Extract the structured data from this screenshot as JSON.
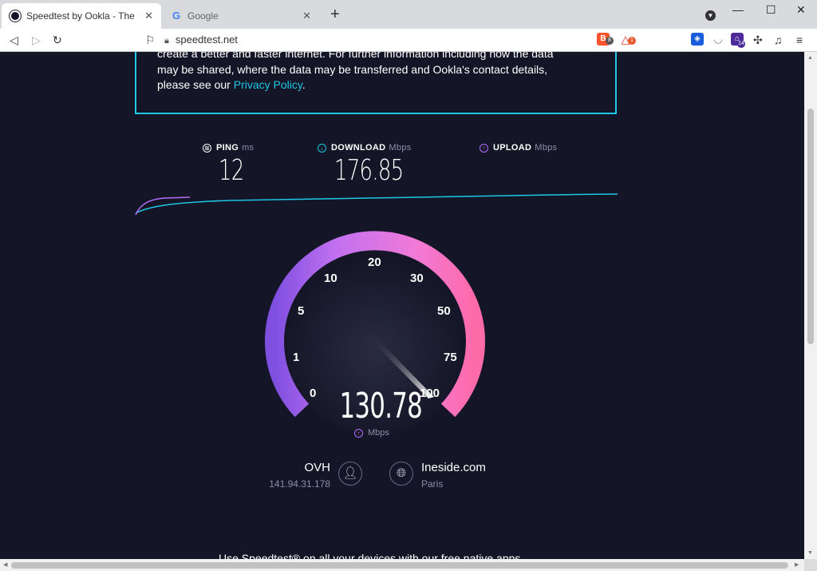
{
  "browser": {
    "tabs": [
      {
        "title": "Speedtest by Ookla - The Global Broadband Speed Test",
        "active": true
      },
      {
        "title": "Google",
        "active": false
      }
    ],
    "url": "speedtest.net",
    "extensions": {
      "brave_badge": "8",
      "rewards_badge": "1",
      "purple_ext_badge": "14"
    }
  },
  "privacy": {
    "line1": "create a better and faster internet. For further information including how the data",
    "line2": "may be shared, where the data may be transferred and Ookla's contact details,",
    "line3_prefix": "please see our ",
    "link": "Privacy Policy",
    "line3_suffix": "."
  },
  "metrics": {
    "ping": {
      "label": "PING",
      "unit": "ms",
      "value": "12"
    },
    "download": {
      "label": "DOWNLOAD",
      "unit": "Mbps",
      "value": "176.85"
    },
    "upload": {
      "label": "UPLOAD",
      "unit": "Mbps",
      "value": ""
    }
  },
  "gauge": {
    "ticks": [
      "0",
      "1",
      "5",
      "10",
      "20",
      "30",
      "50",
      "75",
      "100"
    ],
    "value": "130.78",
    "unit": "Mbps"
  },
  "isp": {
    "name": "OVH",
    "ip": "141.94.31.178"
  },
  "server": {
    "name": "Ineside.com",
    "location": "Paris"
  },
  "footer": {
    "text": "Use Speedtest® on all your devices with our free native apps."
  },
  "colors": {
    "background": "#141526",
    "accent_cyan": "#1ec8e6",
    "upload_purple": "#b36cf7",
    "gauge_pink": "#ff7ad8"
  }
}
